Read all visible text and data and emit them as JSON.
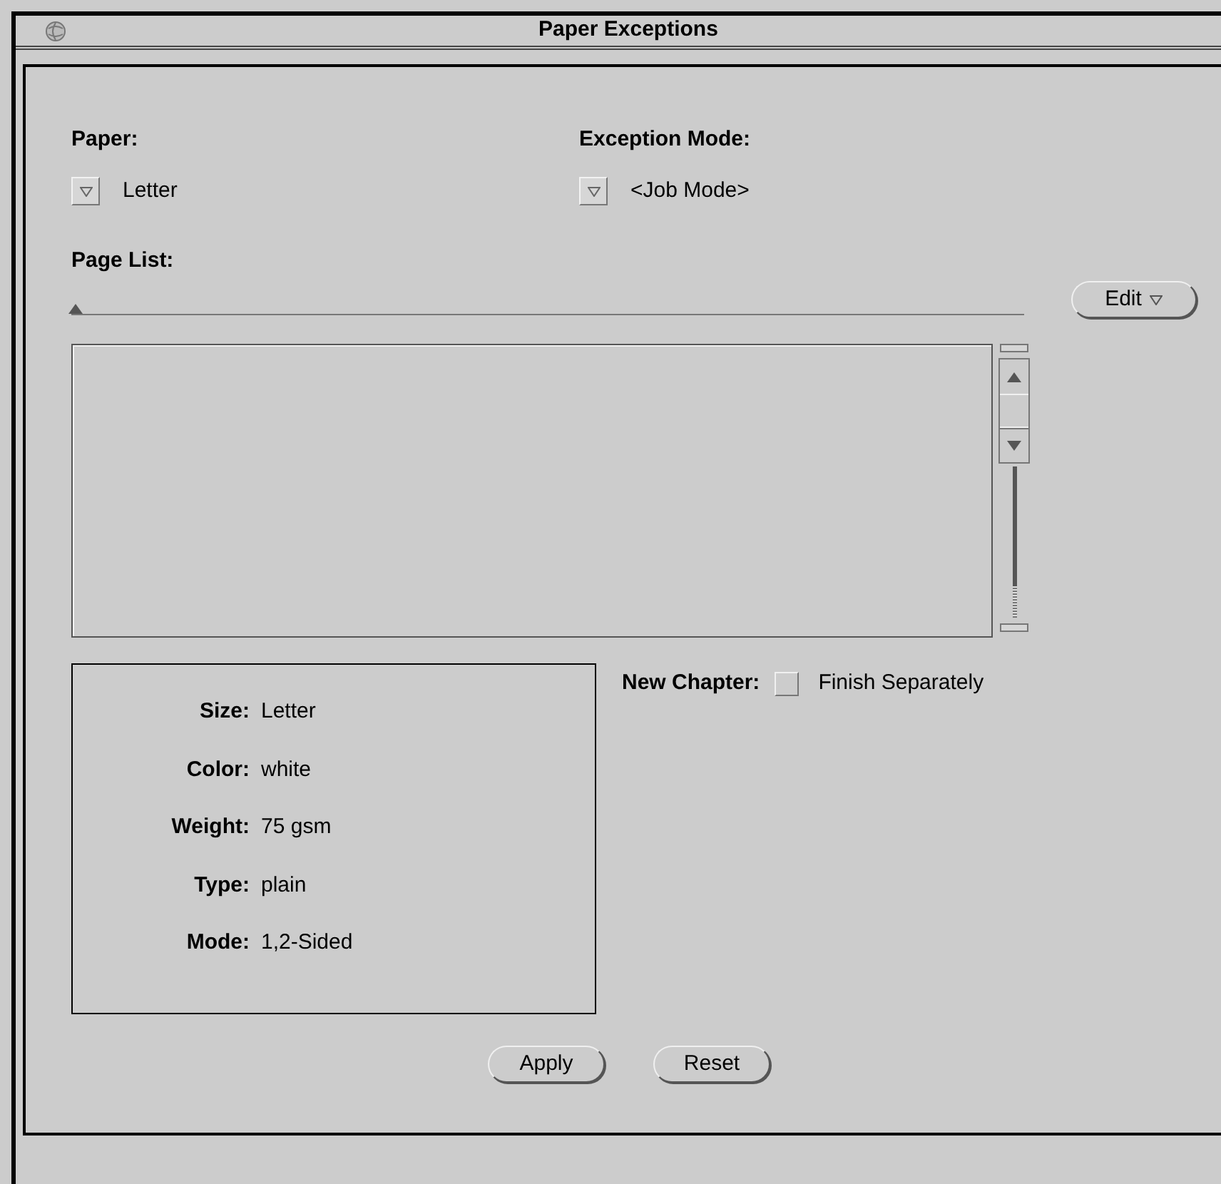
{
  "window": {
    "title": "Paper Exceptions"
  },
  "paper": {
    "label": "Paper:",
    "value": "Letter"
  },
  "exception_mode": {
    "label": "Exception Mode:",
    "value": "<Job Mode>"
  },
  "page_list": {
    "label": "Page List:",
    "level": 0,
    "edit_button": "Edit"
  },
  "paper_info": [
    {
      "label": "Size:",
      "value": "Letter"
    },
    {
      "label": "Color:",
      "value": "white"
    },
    {
      "label": "Weight:",
      "value": "75 gsm"
    },
    {
      "label": "Type:",
      "value": "plain"
    },
    {
      "label": "Mode:",
      "value": "1,2-Sided"
    }
  ],
  "new_chapter": {
    "label": "New Chapter:",
    "checked": false,
    "option": "Finish Separately"
  },
  "buttons": [
    "Apply",
    "Reset"
  ]
}
